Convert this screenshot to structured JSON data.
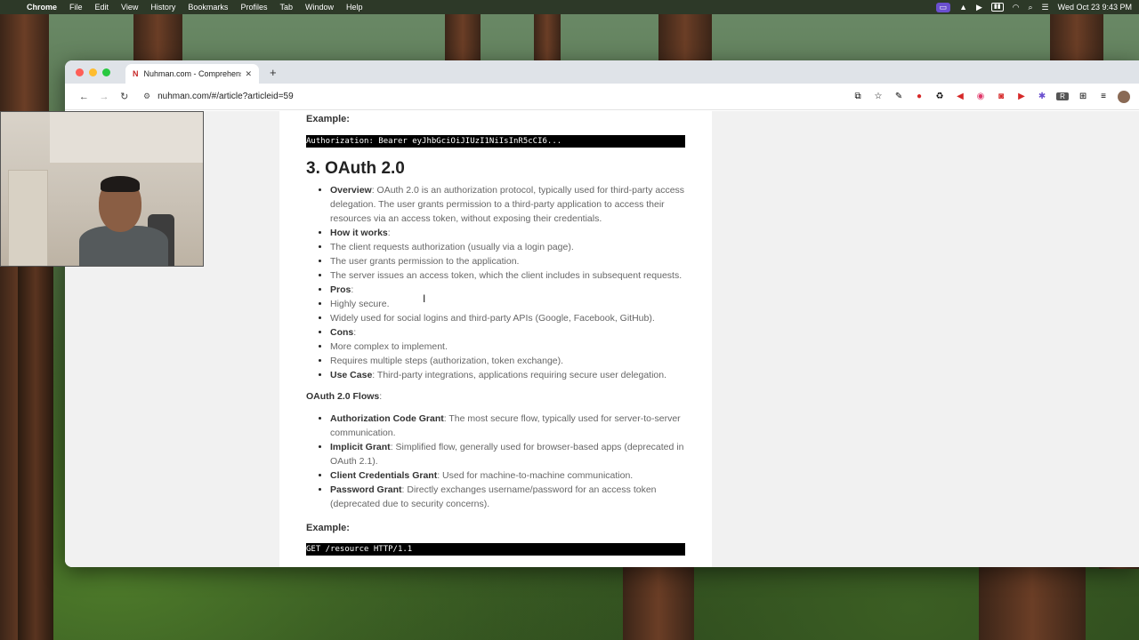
{
  "menubar": {
    "app_name": "Chrome",
    "menus": [
      "File",
      "Edit",
      "View",
      "History",
      "Bookmarks",
      "Profiles",
      "Tab",
      "Window",
      "Help"
    ],
    "clock": "Wed Oct 23  9:43 PM"
  },
  "browser": {
    "tab_favicon": "N",
    "tab_title": "Nuhman.com - Comprehensi",
    "url": "nuhman.com/#/article?articleid=59"
  },
  "article": {
    "example_label_top": "Example:",
    "code_top": "Authorization: Bearer eyJhbGciOiJIUzI1NiIsInR5cCI6...",
    "section_heading": "3. OAuth 2.0",
    "bullets": [
      {
        "bold": "Overview",
        "text": ": OAuth 2.0 is an authorization protocol, typically used for third-party access delegation. The user grants permission to a third-party application to access their resources via an access token, without exposing their credentials."
      },
      {
        "bold": "How it works",
        "text": ":"
      },
      {
        "bold": "",
        "text": "The client requests authorization (usually via a login page)."
      },
      {
        "bold": "",
        "text": "The user grants permission to the application."
      },
      {
        "bold": "",
        "text": "The server issues an access token, which the client includes in subsequent requests."
      },
      {
        "bold": "Pros",
        "text": ":"
      },
      {
        "bold": "",
        "text": "Highly secure."
      },
      {
        "bold": "",
        "text": "Widely used for social logins and third-party APIs (Google, Facebook, GitHub)."
      },
      {
        "bold": "Cons",
        "text": ":"
      },
      {
        "bold": "",
        "text": "More complex to implement."
      },
      {
        "bold": "",
        "text": "Requires multiple steps (authorization, token exchange)."
      },
      {
        "bold": "Use Case",
        "text": ": Third-party integrations, applications requiring secure user delegation."
      }
    ],
    "flows_label": "OAuth 2.0 Flows",
    "flows_colon": ":",
    "flows": [
      {
        "bold": "Authorization Code Grant",
        "text": ": The most secure flow, typically used for server-to-server communication."
      },
      {
        "bold": "Implicit Grant",
        "text": ": Simplified flow, generally used for browser-based apps (deprecated in OAuth 2.1)."
      },
      {
        "bold": "Client Credentials Grant",
        "text": ": Used for machine-to-machine communication."
      },
      {
        "bold": "Password Grant",
        "text": ": Directly exchanges username/password for an access token (deprecated due to security concerns)."
      }
    ],
    "example_label_bottom": "Example:",
    "code_bottom": "GET /resource HTTP/1.1"
  },
  "icons": {
    "scroll_top": "chevron-up-icon"
  }
}
